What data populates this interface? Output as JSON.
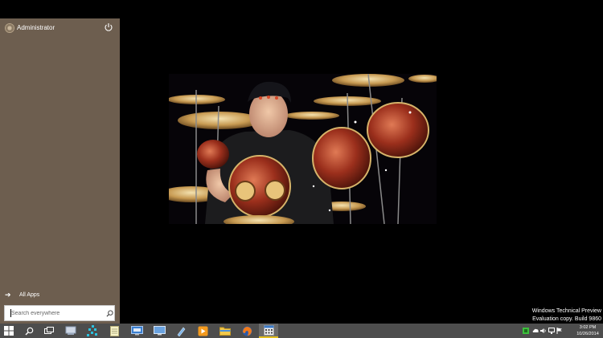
{
  "start_menu": {
    "user_name": "Administrator",
    "all_apps_label": "All Apps",
    "search_placeholder": "Search everywhere",
    "background_color": "#6d5e4f"
  },
  "desktop": {
    "background_color": "#000000",
    "watermark_line1": "Windows Technical Preview",
    "watermark_line2": "Evaluation copy. Build 9860"
  },
  "taskbar": {
    "background_color": "#4d4d4d",
    "buttons": [
      "windows-start-icon",
      "search-icon",
      "task-view-icon",
      "computer-icon",
      "network-grid-icon",
      "notepad-icon",
      "remote-desktop-icon",
      "monitor-icon",
      "pen-tool-icon",
      "media-player-icon",
      "file-explorer-icon",
      "firefox-icon",
      "calendar-app-icon"
    ],
    "tray": {
      "icons": [
        "network-status-icon",
        "onedrive-icon",
        "volume-icon",
        "display-icon",
        "flag-icon"
      ],
      "time": "3:02 PM",
      "date": "10/26/2014"
    }
  }
}
